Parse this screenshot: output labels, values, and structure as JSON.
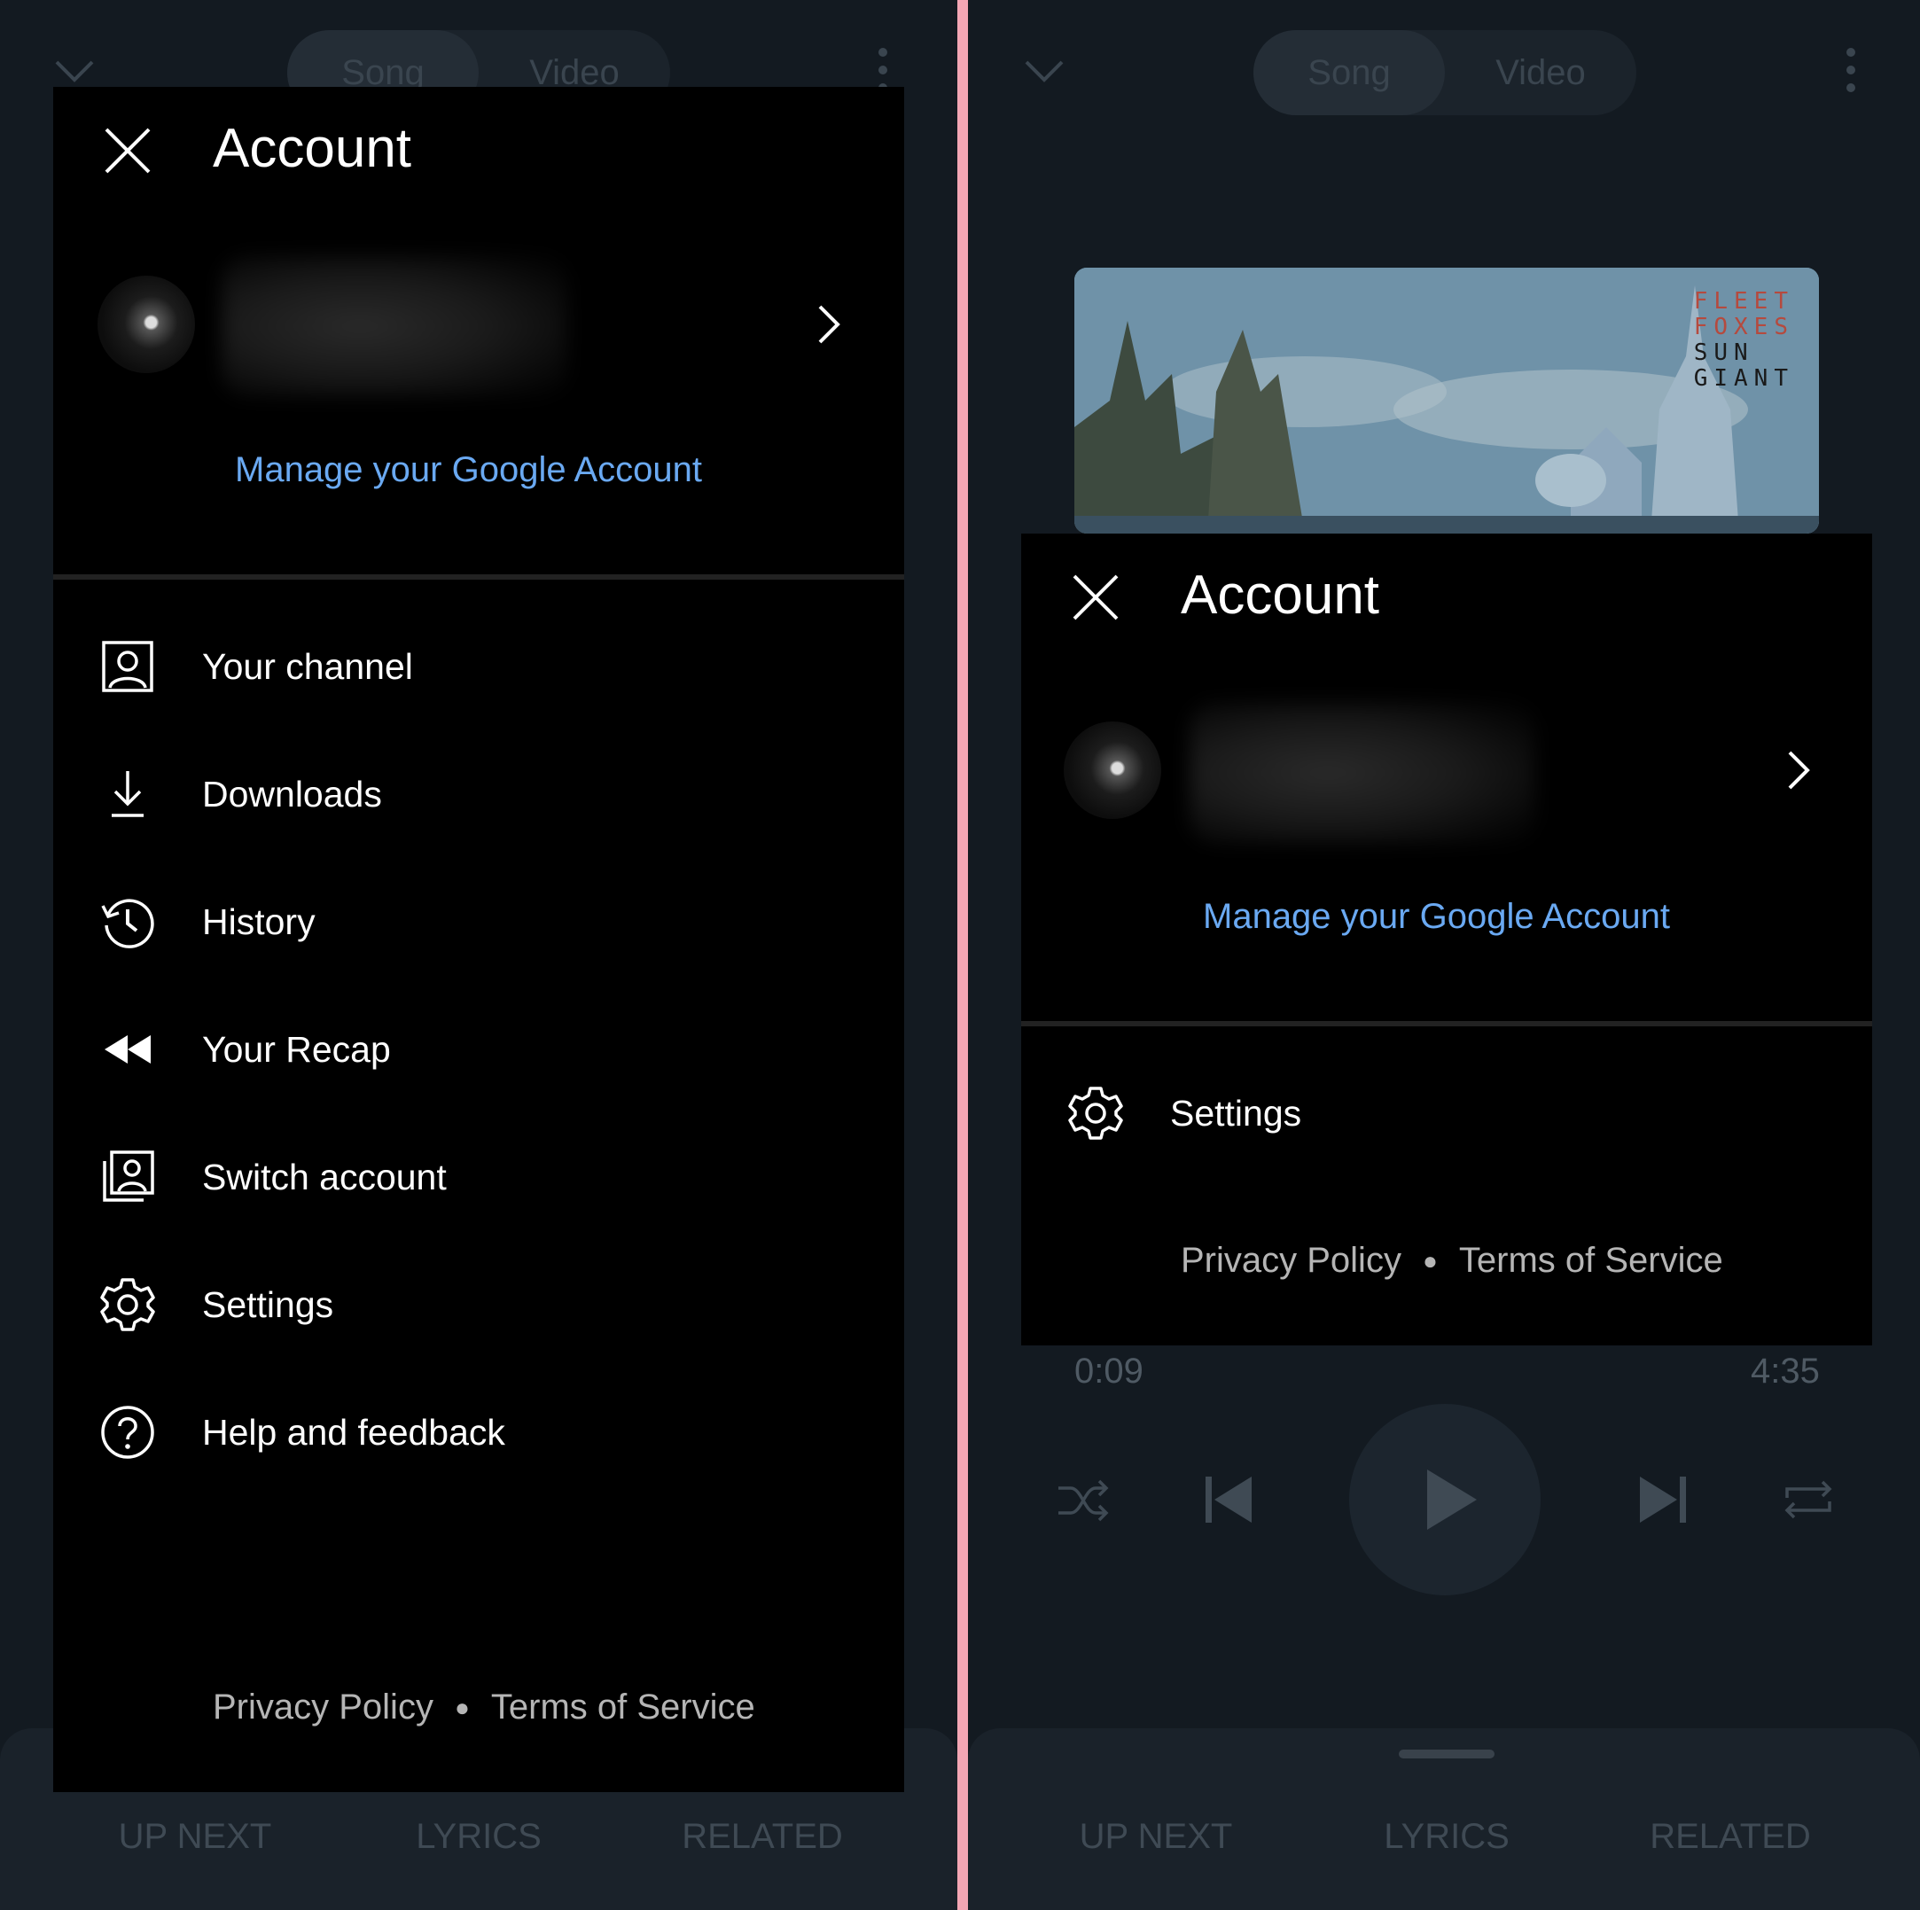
{
  "colors": {
    "background": "#131a21",
    "overlay": "#000000",
    "link": "#6aa9f2",
    "divider": "#f3a6b4",
    "dim_text": "#3f4a54"
  },
  "player": {
    "tabs": [
      "Song",
      "Video"
    ],
    "bottom_tabs": [
      "UP NEXT",
      "LYRICS",
      "RELATED"
    ],
    "time_elapsed": "0:09",
    "time_total": "4:35",
    "album_art_text": [
      "FLEET",
      "FOXES",
      "SUN",
      "GIANT"
    ]
  },
  "account_menu": {
    "title": "Account",
    "manage_link": "Manage your Google Account",
    "items": [
      {
        "label": "Your channel",
        "icon": "person-box-icon"
      },
      {
        "label": "Downloads",
        "icon": "download-icon"
      },
      {
        "label": "History",
        "icon": "history-icon"
      },
      {
        "label": "Your Recap",
        "icon": "rewind-icon"
      },
      {
        "label": "Switch account",
        "icon": "switch-account-icon"
      },
      {
        "label": "Settings",
        "icon": "gear-icon"
      },
      {
        "label": "Help and feedback",
        "icon": "help-icon"
      }
    ],
    "footer": {
      "privacy": "Privacy Policy",
      "terms": "Terms of Service"
    }
  },
  "account_menu_compact": {
    "title": "Account",
    "manage_link": "Manage your Google Account",
    "items": [
      {
        "label": "Settings",
        "icon": "gear-icon"
      }
    ],
    "footer": {
      "privacy": "Privacy Policy",
      "terms": "Terms of Service"
    }
  }
}
